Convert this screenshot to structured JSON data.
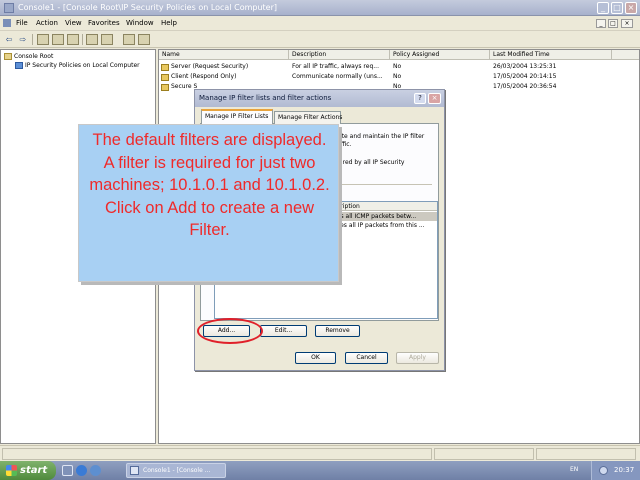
{
  "window": {
    "title": "Console1 - [Console Root\\IP Security Policies on Local Computer]",
    "min": "_",
    "max": "□",
    "close": "×"
  },
  "menu": {
    "file": "File",
    "action": "Action",
    "view": "View",
    "favorites": "Favorites",
    "window": "Window",
    "help": "Help"
  },
  "toolbar": {
    "back": "⇦",
    "forward": "⇨"
  },
  "tree": {
    "root": "Console Root",
    "child": "IP Security Policies on Local Computer"
  },
  "list": {
    "columns": [
      "Name",
      "Description",
      "Policy Assigned",
      "Last Modified Time"
    ],
    "rows": [
      {
        "name": "Server (Request Security)",
        "desc": "For all IP traffic, always req...",
        "assigned": "No",
        "modified": "26/03/2004 13:25:31"
      },
      {
        "name": "Client (Respond Only)",
        "desc": "Communicate normally (uns...",
        "assigned": "No",
        "modified": "17/05/2004 20:14:15"
      },
      {
        "name": "Secure S",
        "desc": "",
        "assigned": "No",
        "modified": "17/05/2004 20:36:54"
      }
    ]
  },
  "dialog": {
    "title": "Manage IP filter lists and filter actions",
    "help": "?",
    "close": "×",
    "tabs": [
      "Manage IP Filter Lists",
      "Manage Filter Actions"
    ],
    "text_line1": "reate and maintain the IP filter",
    "text_line2": "traffic.",
    "text_line3": "shared by all IP Security",
    "list_header_desc": "scription",
    "list_rows": [
      "nes all ICMP packets betw...",
      "ches all IP packets from this ..."
    ],
    "buttons": {
      "add": "Add...",
      "edit": "Edit...",
      "remove": "Remove",
      "ok": "OK",
      "cancel": "Cancel",
      "apply": "Apply"
    }
  },
  "callout": {
    "text": "The default filters are displayed. A filter is required for just two machines; 10.1.0.1 and 10.1.0.2. Click on Add to create a new Filter."
  },
  "taskbar": {
    "start": "start",
    "task": "Console1 - [Console ...",
    "language": "EN",
    "clock": "20:37"
  },
  "colors": {
    "callout_bg": "#a8d0f3",
    "callout_text": "#ef2a2a",
    "highlight": "#e0202a"
  }
}
